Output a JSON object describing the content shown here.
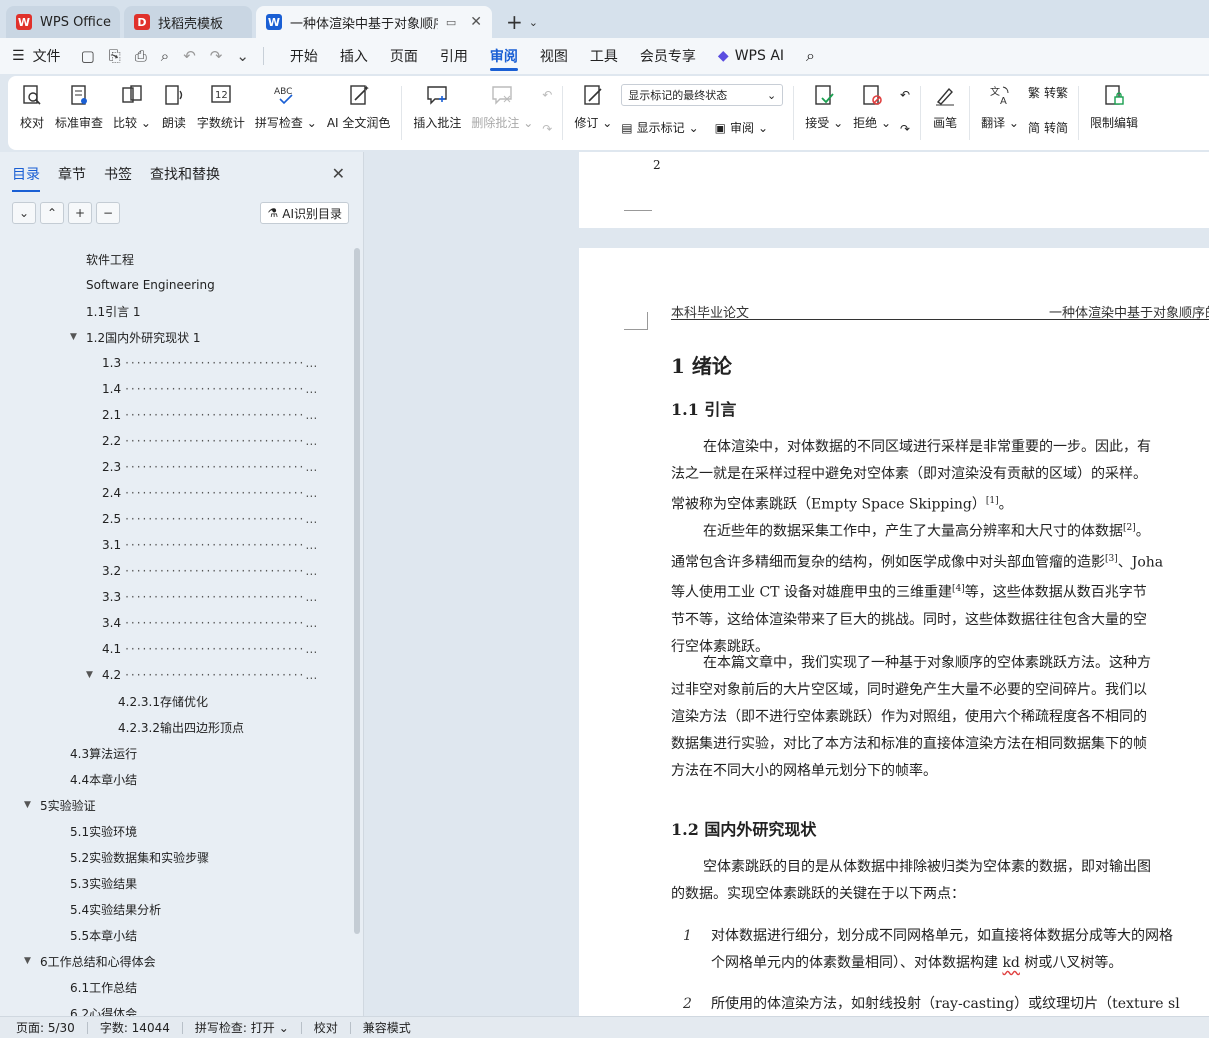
{
  "tabs": [
    {
      "label": "WPS Office",
      "icon": "wps-logo-icon",
      "color": "#e0312b"
    },
    {
      "label": "找稻壳模板",
      "icon": "docer-logo-icon",
      "color": "#e0312b"
    },
    {
      "label": "一种体渲染中基于对象顺序的",
      "icon": "writer-logo-icon",
      "color": "#1a5fd4",
      "active": true
    }
  ],
  "menu": {
    "file": "文件",
    "items": [
      "开始",
      "插入",
      "页面",
      "引用",
      "审阅",
      "视图",
      "工具",
      "会员专享"
    ],
    "active": "审阅",
    "ai": "WPS AI"
  },
  "ribbon": {
    "proofread": "校对",
    "standard_review": "标准审查",
    "compare": "比较",
    "read_aloud": "朗读",
    "word_count": "字数统计",
    "spell_check": "拼写检查",
    "ai_polish": "AI 全文润色",
    "insert_comment": "插入批注",
    "delete_comment": "删除批注",
    "track_changes": "修订",
    "markup_select": "显示标记的最终状态",
    "show_markup": "显示标记",
    "review_pane": "审阅",
    "accept": "接受",
    "reject": "拒绝",
    "pen": "画笔",
    "translate": "翻译",
    "to_traditional": "转繁",
    "to_simplified": "转简",
    "restrict_editing": "限制编辑"
  },
  "nav": {
    "tabs": [
      "目录",
      "章节",
      "书签",
      "查找和替换"
    ],
    "active_tab": "目录",
    "ai_toc": "AI识别目录",
    "toc": [
      {
        "label": "软件工程",
        "level": 3
      },
      {
        "label": "Software Engineering",
        "level": 3
      },
      {
        "label": "1.1引言  1",
        "level": 3
      },
      {
        "label": "1.2国内外研究现状  1",
        "level": 3,
        "expanded": true
      },
      {
        "label": "1.3",
        "level": 4,
        "dots": true
      },
      {
        "label": "1.4",
        "level": 4,
        "dots": true
      },
      {
        "label": "2.1",
        "level": 4,
        "dots": true
      },
      {
        "label": "2.2",
        "level": 4,
        "dots": true
      },
      {
        "label": "2.3",
        "level": 4,
        "dots": true
      },
      {
        "label": "2.4",
        "level": 4,
        "dots": true
      },
      {
        "label": "2.5",
        "level": 4,
        "dots": true
      },
      {
        "label": "3.1",
        "level": 4,
        "dots": true
      },
      {
        "label": "3.2",
        "level": 4,
        "dots": true
      },
      {
        "label": "3.3",
        "level": 4,
        "dots": true
      },
      {
        "label": "3.4",
        "level": 4,
        "dots": true
      },
      {
        "label": "4.1",
        "level": 4,
        "dots": true
      },
      {
        "label": "4.2",
        "level": 4,
        "dots": true,
        "expanded": true
      },
      {
        "label": "4.2.3.1存储优化",
        "level": 5
      },
      {
        "label": "4.2.3.2输出四边形顶点",
        "level": 5
      },
      {
        "label": "4.3算法运行",
        "level": 2
      },
      {
        "label": "4.4本章小结",
        "level": 2
      },
      {
        "label": "5实验验证",
        "level": 1,
        "expanded": true
      },
      {
        "label": "5.1实验环境",
        "level": 2
      },
      {
        "label": "5.2实验数据集和实验步骤",
        "level": 2
      },
      {
        "label": "5.3实验结果",
        "level": 2
      },
      {
        "label": "5.4实验结果分析",
        "level": 2
      },
      {
        "label": "5.5本章小结",
        "level": 2
      },
      {
        "label": "6工作总结和心得体会",
        "level": 1,
        "expanded": true
      },
      {
        "label": "6.1工作总结",
        "level": 2
      },
      {
        "label": "6.2心得体会",
        "level": 2
      }
    ]
  },
  "doc": {
    "prev_page_number": "2",
    "header_left": "本科毕业论文",
    "header_right": "一种体渲染中基于对象顺序的空",
    "chapter": "1   绪论",
    "sec1": "1.1    引言",
    "p1": [
      "在体渲染中，对体数据的不同区域进行采样是非常重要的一步。因此，有",
      "法之一就是在采样过程中避免对空体素（即对渲染没有贡献的区域）的采样。",
      "常被称为空体素跳跃（Empty Space Skipping）",
      "[1]",
      "。"
    ],
    "p2": [
      "在近些年的数据采集工作中，产生了大量高分辨率和大尺寸的体数据",
      "[2]",
      "。",
      "通常包含许多精细而复杂的结构，例如医学成像中对头部血管瘤的造影",
      "[3]",
      "、Joha",
      "等人使用工业 CT 设备对雄鹿甲虫的三维重建",
      "[4]",
      "等，这些体数据从数百兆字节",
      "节不等，这给体渲染带来了巨大的挑战。同时，这些体数据往往包含大量的空",
      "行空体素跳跃。"
    ],
    "p3": [
      "在本篇文章中，我们实现了一种基于对象顺序的空体素跳跃方法。这种方",
      "过非空对象前后的大片空区域，同时避免产生大量不必要的空间碎片。我们以",
      "渲染方法（即不进行空体素跳跃）作为对照组，使用六个稀疏程度各不相同的",
      "数据集进行实验，对比了本方法和标准的直接体渲染方法在相同数据集下的帧",
      "方法在不同大小的网格单元划分下的帧率。"
    ],
    "sec2": "1.2    国内外研究现状",
    "p4": [
      "空体素跳跃的目的是从体数据中排除被归类为空体素的数据，即对输出图",
      "的数据。实现空体素跳跃的关键在于以下两点："
    ],
    "b1_num": "1",
    "b1": [
      "对体数据进行细分，划分成不同网格单元，如直接将体数据分成等大的网格",
      "个网格单元内的体素数量相同）、对体数据构建 ",
      "kd",
      " 树或八叉树等。"
    ],
    "b2_num": "2",
    "b2": "所使用的体渲染方法，如射线投射（ray-casting）或纹理切片（texture sl"
  },
  "status": {
    "page": "页面: 5/30",
    "words": "字数: 14044",
    "spell": "拼写检查: 打开",
    "proof": "校对",
    "compat": "兼容模式"
  }
}
